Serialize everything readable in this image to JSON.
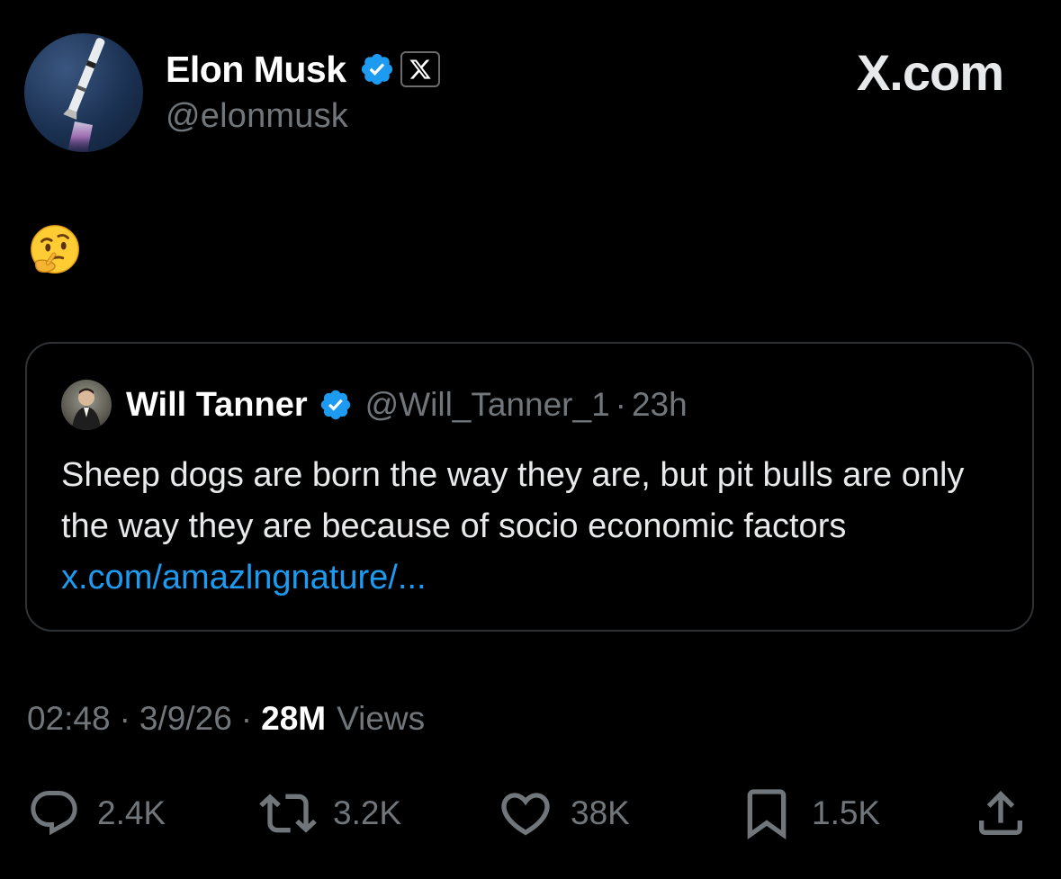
{
  "post": {
    "author_name": "Elon Musk",
    "author_handle": "@elonmusk",
    "body_emoji": "🤔",
    "timestamp_time": "02:48",
    "timestamp_date": "3/9/26",
    "views_count": "28M",
    "views_label": "Views"
  },
  "brand": {
    "label": "X.com"
  },
  "quote": {
    "author_name": "Will Tanner",
    "author_handle": "@Will_Tanner_1",
    "separator": "·",
    "time_ago": "23h",
    "text": "Sheep dogs are born the way they are, but pit bulls are only the way they are because of socio economic factors ",
    "link_text": "x.com/amazlngnature/..."
  },
  "meta": {
    "separator": "·"
  },
  "actions": {
    "replies": "2.4K",
    "reposts": "3.2K",
    "likes": "38K",
    "bookmarks": "1.5K"
  },
  "colors": {
    "background": "#000000",
    "text_primary": "#e7e9ea",
    "text_secondary": "#71767b",
    "link": "#1d9bf0",
    "verified": "#1d9bf0",
    "border": "#2f3336"
  },
  "icons": {
    "verified": "verified-badge-icon",
    "affiliation": "x-logo-icon",
    "reply": "reply-icon",
    "repost": "repost-icon",
    "like": "heart-icon",
    "bookmark": "bookmark-icon",
    "share": "share-icon"
  }
}
